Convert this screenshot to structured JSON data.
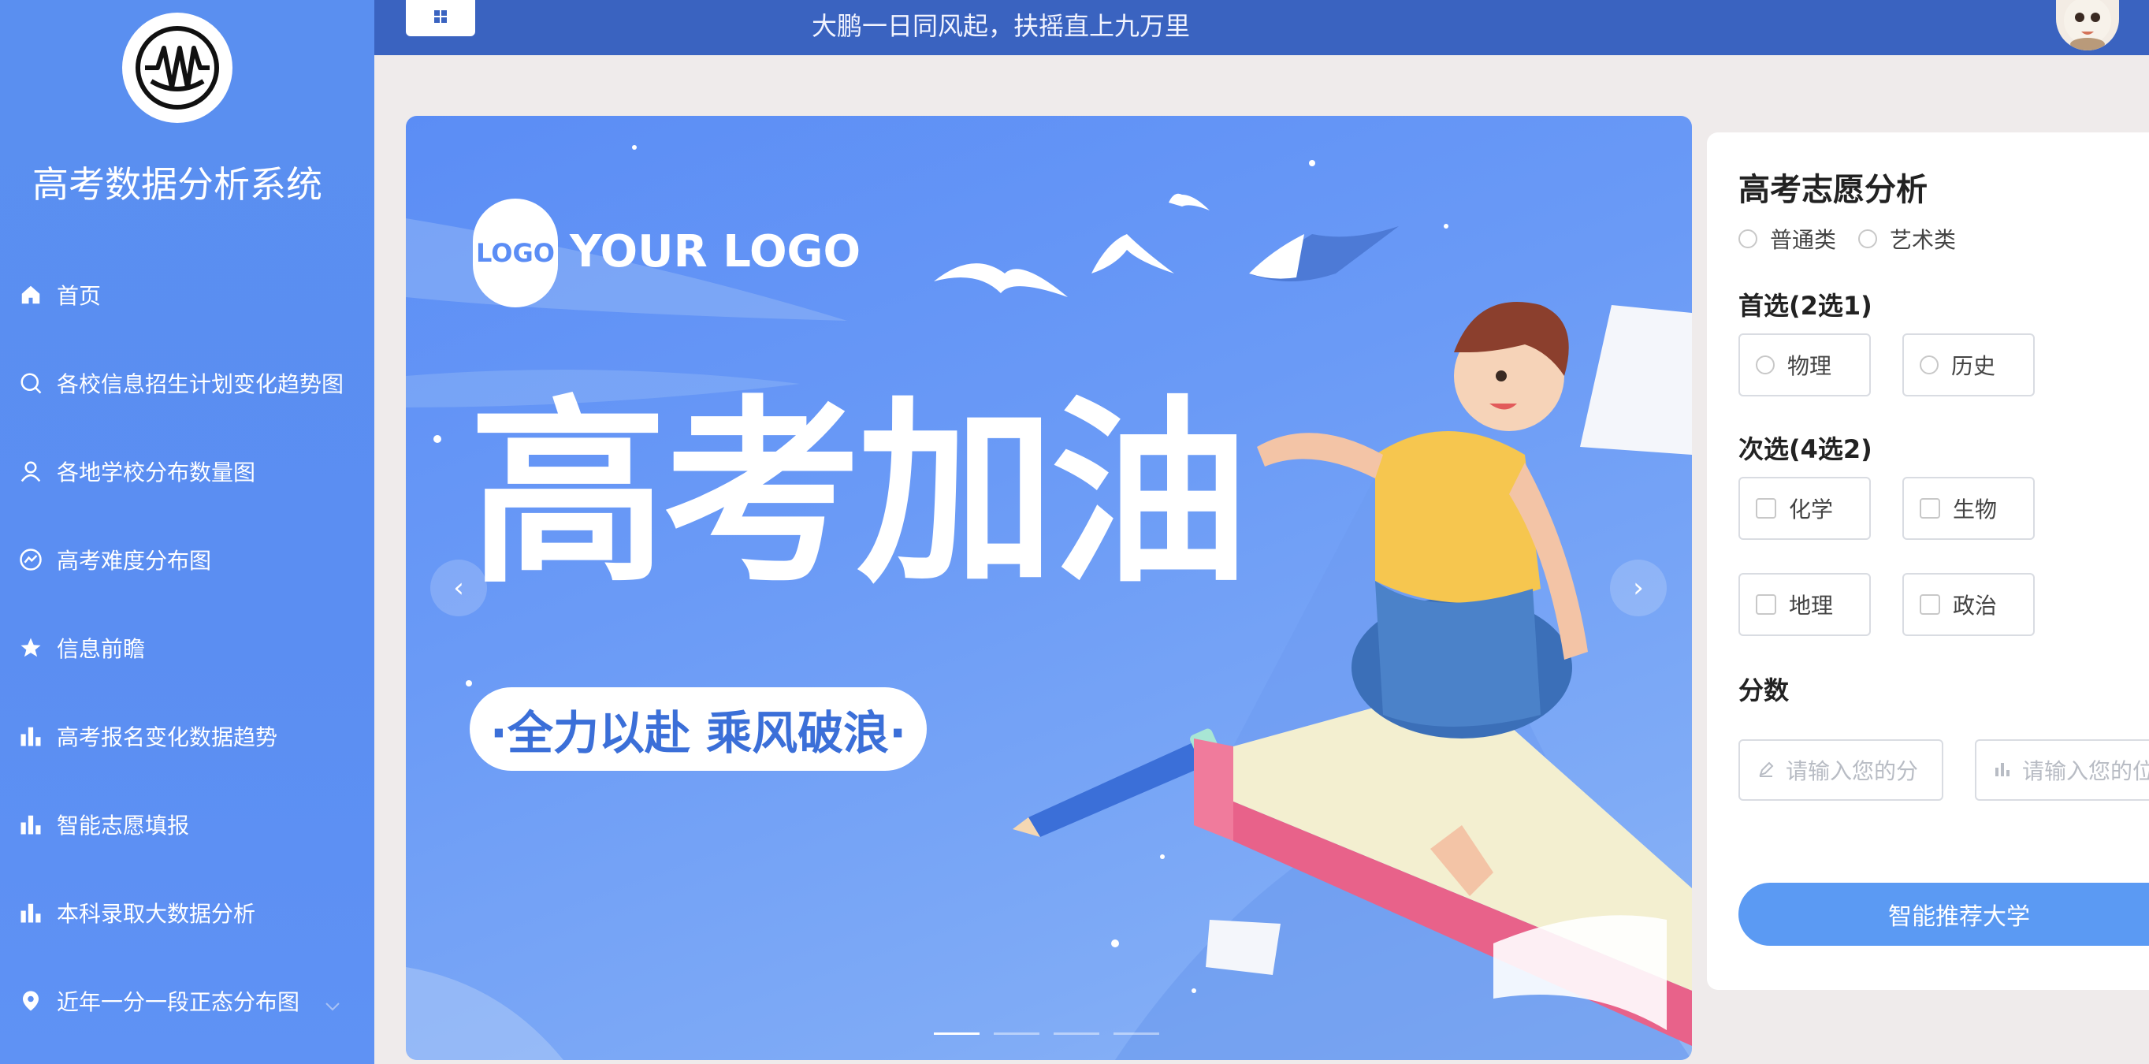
{
  "app": {
    "title": "高考数据分析系统",
    "slogan": "大鹏一日同风起，扶摇直上九万里"
  },
  "sidebar": {
    "items": [
      {
        "label": "首页",
        "icon": "home-icon"
      },
      {
        "label": "各校信息招生计划变化趋势图",
        "icon": "search-icon"
      },
      {
        "label": "各地学校分布数量图",
        "icon": "user-icon"
      },
      {
        "label": "高考难度分布图",
        "icon": "chart-circle-icon"
      },
      {
        "label": "信息前瞻",
        "icon": "star-icon"
      },
      {
        "label": "高考报名变化数据趋势",
        "icon": "bar-chart-icon"
      },
      {
        "label": "智能志愿填报",
        "icon": "bar-chart-icon"
      },
      {
        "label": "本科录取大数据分析",
        "icon": "bar-chart-icon"
      },
      {
        "label": "近年一分一段正态分布图",
        "icon": "location-icon"
      }
    ]
  },
  "banner": {
    "logo_badge": "LOGO",
    "logo_text": "YOUR LOGO",
    "headline": "高考加油",
    "tagline": "·全力以赴 乘风破浪·",
    "slides": 4,
    "active_slide": 1
  },
  "panel": {
    "title": "高考志愿分析",
    "type_options": [
      "普通类",
      "艺术类"
    ],
    "first_choice": {
      "title": "首选(2选1)",
      "options": [
        "物理",
        "历史"
      ]
    },
    "second_choice": {
      "title": "次选(4选2)",
      "options": [
        "化学",
        "生物",
        "地理",
        "政治"
      ]
    },
    "score": {
      "title": "分数",
      "score_placeholder": "请输入您的分",
      "rank_placeholder": "请输入您的位"
    },
    "submit_label": "智能推荐大学"
  },
  "colors": {
    "sidebar": "#5b8ef2",
    "topbar": "#3a63c0",
    "accent_button": "#5b9af3"
  }
}
